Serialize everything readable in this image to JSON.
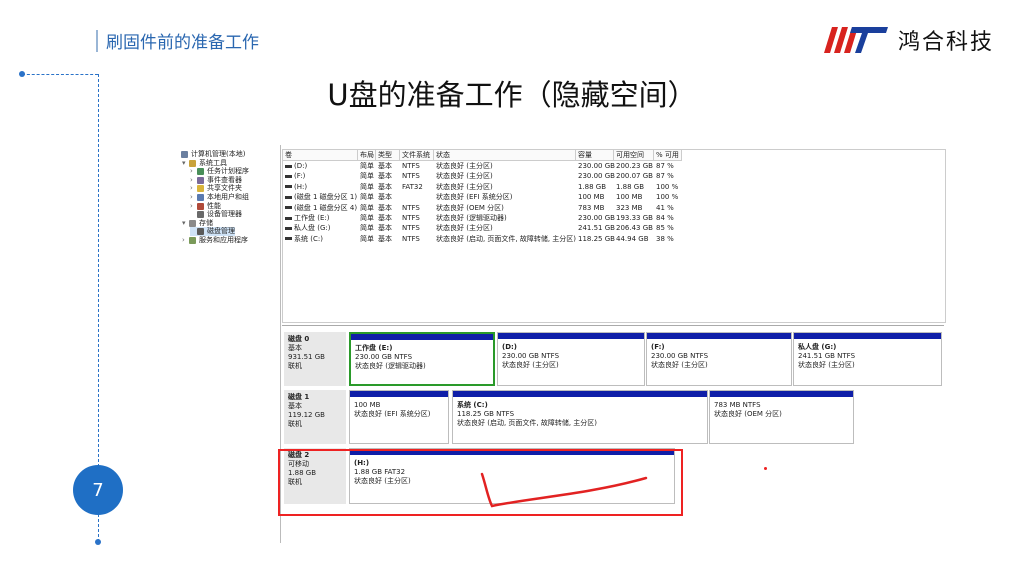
{
  "slide": {
    "header_title": "刷固件前的准备工作",
    "main_title": "U盘的准备工作（隐藏空间）",
    "page_number": "7",
    "logo_text": "鸿合科技",
    "accent_color": "#1f6fc5",
    "highlight_color": "#e22222"
  },
  "tree": {
    "items": [
      {
        "label": "计算机管理(本地)",
        "icon": "computer-icon",
        "indent": 0,
        "chevron": ""
      },
      {
        "label": "系统工具",
        "icon": "tools-icon",
        "indent": 1,
        "chevron": "▾"
      },
      {
        "label": "任务计划程序",
        "icon": "clock-icon",
        "indent": 2,
        "chevron": "›"
      },
      {
        "label": "事件查看器",
        "icon": "event-icon",
        "indent": 2,
        "chevron": "›"
      },
      {
        "label": "共享文件夹",
        "icon": "folder-icon",
        "indent": 2,
        "chevron": "›"
      },
      {
        "label": "本地用户和组",
        "icon": "users-icon",
        "indent": 2,
        "chevron": "›"
      },
      {
        "label": "性能",
        "icon": "performance-icon",
        "indent": 2,
        "chevron": "›"
      },
      {
        "label": "设备管理器",
        "icon": "device-icon",
        "indent": 2,
        "chevron": ""
      },
      {
        "label": "存储",
        "icon": "storage-icon",
        "indent": 1,
        "chevron": "▾"
      },
      {
        "label": "磁盘管理",
        "icon": "disk-icon",
        "indent": 2,
        "chevron": ""
      },
      {
        "label": "服务和应用程序",
        "icon": "services-icon",
        "indent": 1,
        "chevron": "›"
      }
    ]
  },
  "volumes": {
    "headers": [
      "卷",
      "布局",
      "类型",
      "文件系统",
      "状态",
      "容量",
      "可用空间",
      "% 可用"
    ],
    "rows": [
      [
        "(D:)",
        "简单",
        "基本",
        "NTFS",
        "状态良好 (主分区)",
        "230.00 GB",
        "200.23 GB",
        "87 %"
      ],
      [
        "(F:)",
        "简单",
        "基本",
        "NTFS",
        "状态良好 (主分区)",
        "230.00 GB",
        "200.07 GB",
        "87 %"
      ],
      [
        "(H:)",
        "简单",
        "基本",
        "FAT32",
        "状态良好 (主分区)",
        "1.88 GB",
        "1.88 GB",
        "100 %"
      ],
      [
        "(磁盘 1 磁盘分区 1)",
        "简单",
        "基本",
        "",
        "状态良好 (EFI 系统分区)",
        "100 MB",
        "100 MB",
        "100 %"
      ],
      [
        "(磁盘 1 磁盘分区 4)",
        "简单",
        "基本",
        "NTFS",
        "状态良好 (OEM 分区)",
        "783 MB",
        "323 MB",
        "41 %"
      ],
      [
        "工作盘 (E:)",
        "简单",
        "基本",
        "NTFS",
        "状态良好 (逻辑驱动器)",
        "230.00 GB",
        "193.33 GB",
        "84 %"
      ],
      [
        "私人盘 (G:)",
        "简单",
        "基本",
        "NTFS",
        "状态良好 (主分区)",
        "241.51 GB",
        "206.43 GB",
        "85 %"
      ],
      [
        "系统 (C:)",
        "简单",
        "基本",
        "NTFS",
        "状态良好 (启动, 页面文件, 故障转储, 主分区)",
        "118.25 GB",
        "44.94 GB",
        "38 %"
      ]
    ]
  },
  "disks": [
    {
      "name": "磁盘 0",
      "type": "基本",
      "size": "931.51 GB",
      "status": "联机",
      "partitions": [
        {
          "title": "工作盘 (E:)",
          "size": "230.00 GB NTFS",
          "status": "状态良好 (逻辑驱动器)",
          "selected": true
        },
        {
          "title": "(D:)",
          "size": "230.00 GB NTFS",
          "status": "状态良好 (主分区)"
        },
        {
          "title": "(F:)",
          "size": "230.00 GB NTFS",
          "status": "状态良好 (主分区)"
        },
        {
          "title": "私人盘 (G:)",
          "size": "241.51 GB NTFS",
          "status": "状态良好 (主分区)"
        }
      ]
    },
    {
      "name": "磁盘 1",
      "type": "基本",
      "size": "119.12 GB",
      "status": "联机",
      "partitions": [
        {
          "title": "",
          "size": "100 MB",
          "status": "状态良好 (EFI 系统分区)"
        },
        {
          "title": "系统 (C:)",
          "size": "118.25 GB NTFS",
          "status": "状态良好 (启动, 页面文件, 故障转储, 主分区)"
        },
        {
          "title": "",
          "size": "783 MB NTFS",
          "status": "状态良好 (OEM 分区)"
        }
      ]
    },
    {
      "name": "磁盘 2",
      "type": "可移动",
      "size": "1.88 GB",
      "status": "联机",
      "partitions": [
        {
          "title": "(H:)",
          "size": "1.88 GB FAT32",
          "status": "状态良好 (主分区)"
        }
      ]
    }
  ]
}
